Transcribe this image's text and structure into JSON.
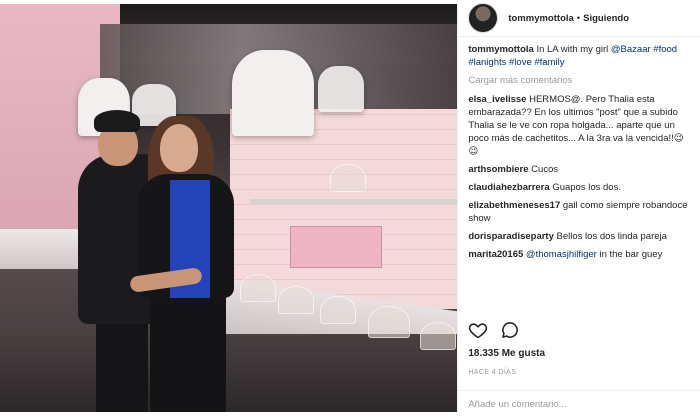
{
  "header": {
    "username": "tommymottola",
    "separator": "•",
    "follow_status": "Siguiendo"
  },
  "caption": {
    "username": "tommymottola",
    "text_before": "In LA with my girl ",
    "mention": "@Bazaar",
    "hashtags": "#food #lanights #love #family"
  },
  "load_more": "Cargar más comentarios",
  "comments": [
    {
      "username": "elsa_ivelisse",
      "text": "HERMOS@. Pero Thalia esta embarazada?? En los ultimos \"post\" que a subido Thalia se le ve con ropa holgada... aparte que un poco más de cachetitos... A la 3ra va la vencida!!😉😉"
    },
    {
      "username": "arthsombiere",
      "text": "Cucos"
    },
    {
      "username": "claudiahezbarrera",
      "text": "Guapos los dos."
    },
    {
      "username": "elizabethmeneses17",
      "text": "gail como siempre robandoce show"
    },
    {
      "username": "dorisparadiseparty",
      "text": "Bellos los dos linda pareja"
    },
    {
      "username": "marita20165",
      "mention": "@thomasjhilfiger",
      "text": " in the bar guey"
    }
  ],
  "actions": {
    "like_icon": "heart-icon",
    "comment_icon": "comment-bubble-icon"
  },
  "likes": "18.335 Me gusta",
  "time_ago": "HACE 4 DÍAS",
  "add_comment": {
    "placeholder": "Añade un comentario..."
  },
  "colors": {
    "text": "#262626",
    "link": "#003569",
    "muted": "#999999",
    "border": "#efefef"
  }
}
